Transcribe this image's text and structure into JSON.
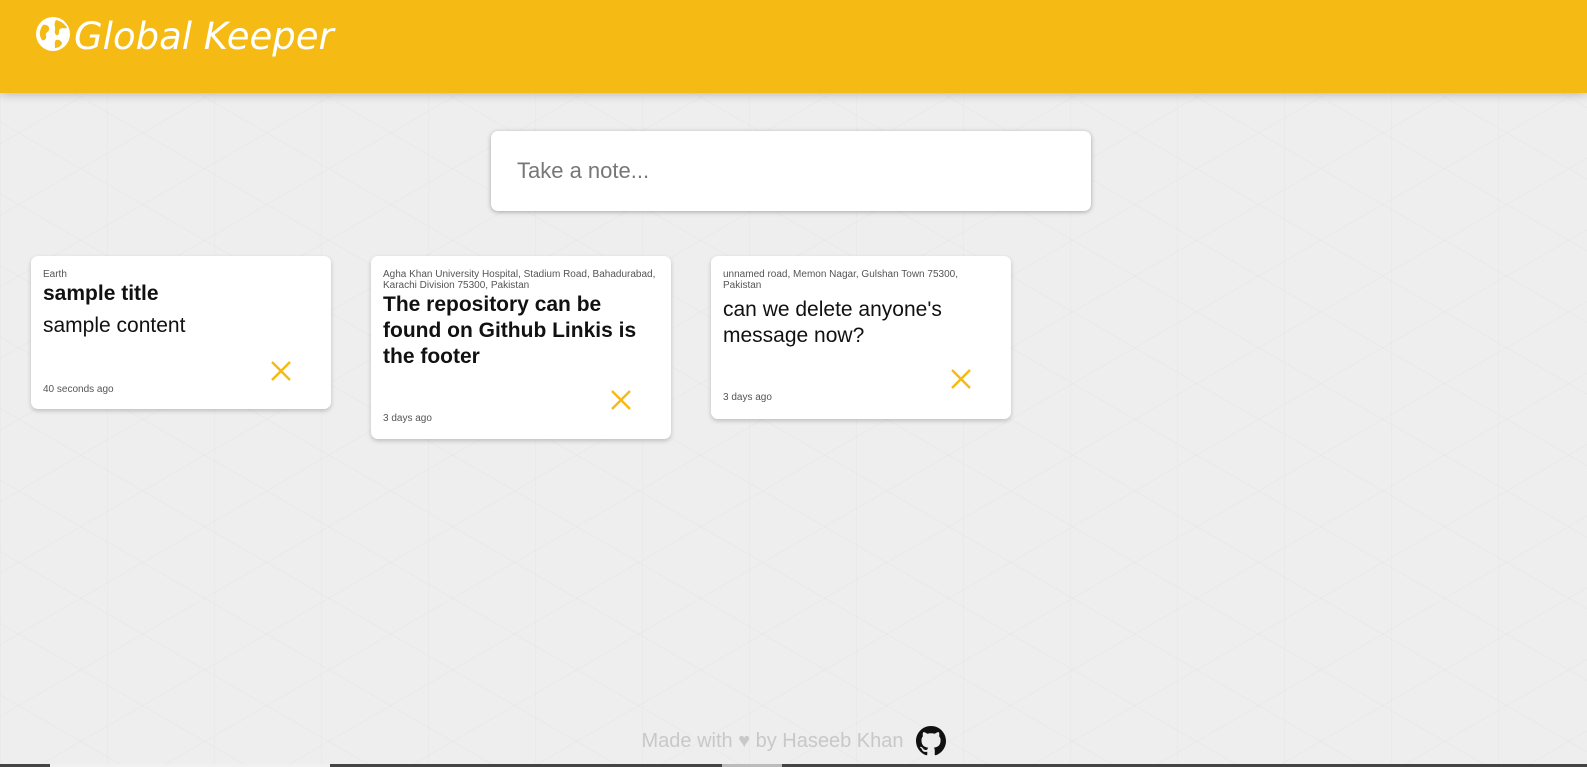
{
  "header": {
    "title": "Global Keeper",
    "brand_color": "#f5ba13",
    "logo_icon": "globe-icon"
  },
  "create_note": {
    "placeholder": "Take a note..."
  },
  "notes": [
    {
      "location": "Earth",
      "title": "sample title",
      "content": "sample content",
      "time": "40 seconds ago",
      "delete_icon": "close-icon"
    },
    {
      "location": "Agha Khan University Hospital, Stadium Road, Bahadurabad, Karachi Division 75300, Pakistan",
      "title": "The repository can be found on Github Linkis is the footer",
      "content": "",
      "time": "3 days ago",
      "delete_icon": "close-icon"
    },
    {
      "location": "unnamed road, Memon Nagar, Gulshan Town 75300, Pakistan",
      "title": "",
      "content": "can we delete anyone's message now?",
      "time": "3 days ago",
      "delete_icon": "close-icon"
    }
  ],
  "footer": {
    "text": "Made with ♥ by Haseeb Khan",
    "icon": "github-icon"
  }
}
